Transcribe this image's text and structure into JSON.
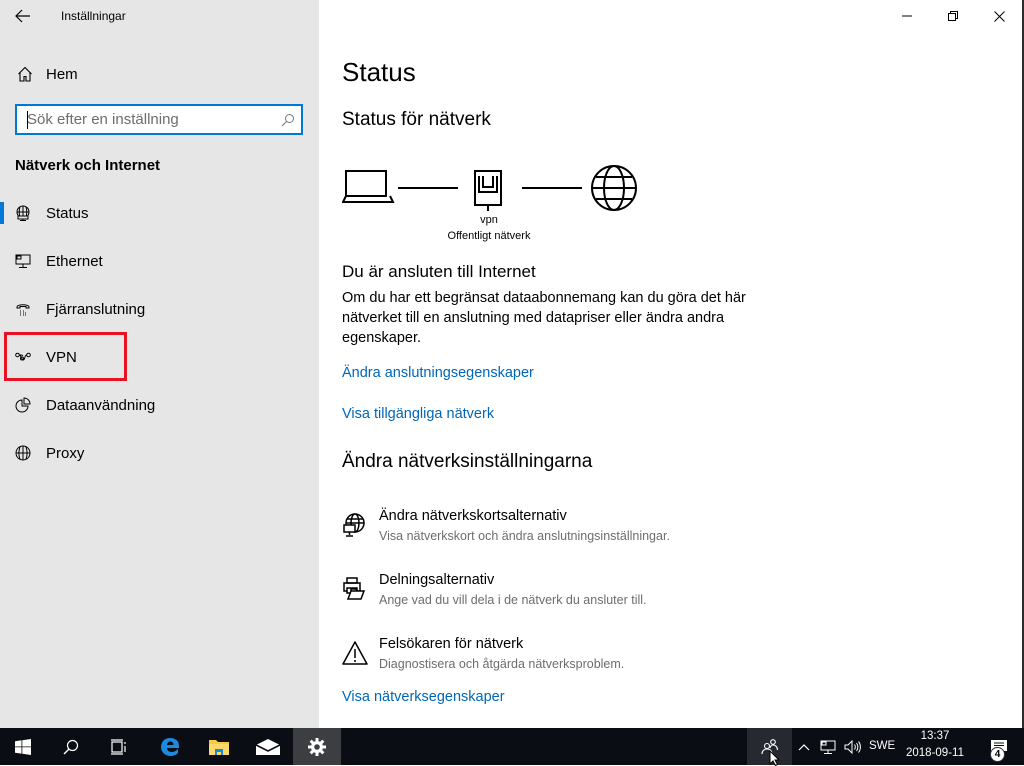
{
  "window": {
    "title": "Inställningar",
    "controls": {
      "minimize": "minimize",
      "maximize": "restore",
      "close": "close"
    }
  },
  "sidebar": {
    "home_label": "Hem",
    "search": {
      "placeholder": "Sök efter en inställning",
      "value": ""
    },
    "section_title": "Nätverk och Internet",
    "items": [
      {
        "label": "Status",
        "icon": "network-status-icon",
        "active": true
      },
      {
        "label": "Ethernet",
        "icon": "ethernet-icon",
        "active": false
      },
      {
        "label": "Fjärranslutning",
        "icon": "dialup-icon",
        "active": false
      },
      {
        "label": "VPN",
        "icon": "vpn-icon",
        "active": false,
        "highlighted": true
      },
      {
        "label": "Dataanvändning",
        "icon": "data-usage-icon",
        "active": false
      },
      {
        "label": "Proxy",
        "icon": "globe-icon",
        "active": false
      }
    ],
    "highlight_color": "#e81123"
  },
  "main": {
    "title": "Status",
    "network_status_heading": "Status för nätverk",
    "diagram": {
      "network_name": "vpn",
      "network_type": "Offentligt nätverk"
    },
    "connected_heading": "Du är ansluten till Internet",
    "connected_description": "Om du har ett begränsat dataabonnemang kan du göra det här nätverket till en anslutning med datapriser eller ändra andra egenskaper.",
    "links": {
      "change_connection_properties": "Ändra anslutningsegenskaper",
      "show_available_networks": "Visa tillgängliga nätverk",
      "view_network_properties": "Visa nätverksegenskaper"
    },
    "change_settings_heading": "Ändra nätverksinställningarna",
    "settings": [
      {
        "title": "Ändra nätverkskortsalternativ",
        "description": "Visa nätverkskort och ändra anslutningsinställningar.",
        "icon": "adapter-options-icon"
      },
      {
        "title": "Delningsalternativ",
        "description": "Ange vad du vill dela i de nätverk du ansluter till.",
        "icon": "sharing-options-icon"
      },
      {
        "title": "Felsökaren för nätverk",
        "description": "Diagnostisera och åtgärda nätverksproblem.",
        "icon": "warning-icon"
      }
    ],
    "accent_color": "#0078d7",
    "link_color": "#0067b8"
  },
  "taskbar": {
    "pinned": [
      "start",
      "search",
      "task-view",
      "edge",
      "file-explorer",
      "mail",
      "settings"
    ],
    "active_app": "settings",
    "tray": {
      "language": "SWE",
      "time": "13:37",
      "date": "2018-09-11",
      "notification_count": "4"
    }
  }
}
